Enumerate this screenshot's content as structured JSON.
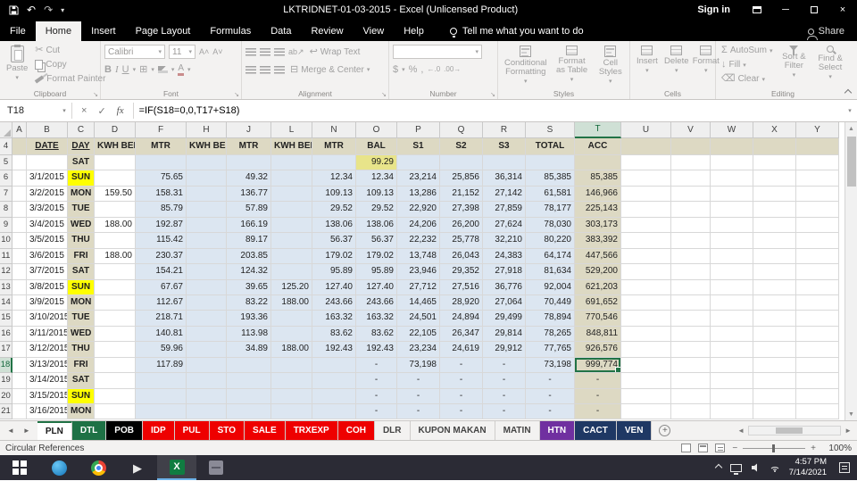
{
  "colors": {
    "accent_green": "#217346",
    "titlebar_bg": "#000000",
    "ribbon_bg": "#f3f2f1",
    "data_band_bg": "#dce6f1",
    "tan_bg": "#ddd9c3",
    "sun_bg": "#ffff00",
    "bal_bg": "#e8e48a",
    "excel_icon_green": "#107c41",
    "taskbar_bg": "#2b2b35"
  },
  "icons": {
    "dropdown": "▾",
    "launcher": "↘",
    "scissors": "✂",
    "undo": "↶",
    "redo": "↷",
    "check": "✓",
    "cancel": "×",
    "close": "×",
    "minimize": "─",
    "sigma": "Σ",
    "play": "▶",
    "up": "▲",
    "down": "▼",
    "left": "◄",
    "right": "►",
    "minus": "−",
    "plus": "+",
    "bold": "B",
    "italic": "I",
    "underline": "U",
    "dollar": "$",
    "percent": "%",
    "comma": ",",
    "dec_inc": "←.0",
    "dec_dec": ".00→",
    "wrap": "↩",
    "orientation": "ab↗",
    "grow_font": "A˄",
    "shrink_font": "A˅",
    "borders": "⊞",
    "merge": "⊟",
    "fill_down": "↓",
    "clear": "⌫",
    "sort_az": "AZ"
  },
  "titlebar": {
    "title": "LKTRIDNET-01-03-2015 - Excel (Unlicensed Product)",
    "sign_in": "Sign in"
  },
  "ribbon": {
    "tabs": [
      "File",
      "Home",
      "Insert",
      "Page Layout",
      "Formulas",
      "Data",
      "Review",
      "View",
      "Help"
    ],
    "active_tab": "Home",
    "tell_me": "Tell me what you want to do",
    "share": "Share",
    "groups": {
      "clipboard": {
        "label": "Clipboard",
        "paste": "Paste",
        "cut": "Cut",
        "copy": "Copy",
        "format_painter": "Format Painter"
      },
      "font": {
        "label": "Font",
        "name": "Calibri",
        "size": "11"
      },
      "alignment": {
        "label": "Alignment",
        "wrap": "Wrap Text",
        "merge": "Merge & Center"
      },
      "number": {
        "label": "Number",
        "format": ""
      },
      "styles": {
        "label": "Styles",
        "conditional": "Conditional Formatting",
        "table": "Format as Table",
        "cell": "Cell Styles"
      },
      "cells": {
        "label": "Cells",
        "insert": "Insert",
        "delete": "Delete",
        "format": "Format"
      },
      "editing": {
        "label": "Editing",
        "autosum": "AutoSum",
        "fill": "Fill",
        "clear": "Clear",
        "sort": "Sort & Filter",
        "find": "Find & Select"
      }
    }
  },
  "formula_bar": {
    "name_box": "T18",
    "fx": "fx",
    "formula": "=IF(S18=0,0,T17+S18)"
  },
  "grid": {
    "columns": [
      "A",
      "B",
      "C",
      "D",
      "F",
      "H",
      "J",
      "L",
      "N",
      "O",
      "P",
      "Q",
      "R",
      "S",
      "T",
      "U",
      "V",
      "W",
      "X",
      "Y"
    ],
    "selection": {
      "cell": "T18",
      "row": 18,
      "col": "T"
    },
    "rows": [
      {
        "n": 4,
        "type": "header",
        "cells": {
          "B": "DATE",
          "C": "DAY",
          "D": "KWH BELI",
          "F": "MTR",
          "H": "KWH BELI",
          "J": "MTR",
          "L": "KWH BELI",
          "N": "MTR",
          "O": "BAL",
          "P": "S1",
          "Q": "S2",
          "R": "S3",
          "S": "TOTAL",
          "T": "ACC"
        }
      },
      {
        "n": 5,
        "cells": {
          "C": "SAT",
          "O": "99.29"
        }
      },
      {
        "n": 6,
        "cells": {
          "B": "3/1/2015",
          "C": "SUN",
          "F": "75.65",
          "J": "49.32",
          "N": "12.34",
          "O": "12.34",
          "P": "23,214",
          "Q": "25,856",
          "R": "36,314",
          "S": "85,385",
          "T": "85,385"
        }
      },
      {
        "n": 7,
        "cells": {
          "B": "3/2/2015",
          "C": "MON",
          "D": "159.50",
          "F": "158.31",
          "J": "136.77",
          "N": "109.13",
          "O": "109.13",
          "P": "13,286",
          "Q": "21,152",
          "R": "27,142",
          "S": "61,581",
          "T": "146,966"
        }
      },
      {
        "n": 8,
        "cells": {
          "B": "3/3/2015",
          "C": "TUE",
          "F": "85.79",
          "J": "57.89",
          "N": "29.52",
          "O": "29.52",
          "P": "22,920",
          "Q": "27,398",
          "R": "27,859",
          "S": "78,177",
          "T": "225,143"
        }
      },
      {
        "n": 9,
        "cells": {
          "B": "3/4/2015",
          "C": "WED",
          "D": "188.00",
          "F": "192.87",
          "J": "166.19",
          "N": "138.06",
          "O": "138.06",
          "P": "24,206",
          "Q": "26,200",
          "R": "27,624",
          "S": "78,030",
          "T": "303,173"
        }
      },
      {
        "n": 10,
        "cells": {
          "B": "3/5/2015",
          "C": "THU",
          "F": "115.42",
          "J": "89.17",
          "N": "56.37",
          "O": "56.37",
          "P": "22,232",
          "Q": "25,778",
          "R": "32,210",
          "S": "80,220",
          "T": "383,392"
        }
      },
      {
        "n": 11,
        "cells": {
          "B": "3/6/2015",
          "C": "FRI",
          "D": "188.00",
          "F": "230.37",
          "J": "203.85",
          "N": "179.02",
          "O": "179.02",
          "P": "13,748",
          "Q": "26,043",
          "R": "24,383",
          "S": "64,174",
          "T": "447,566"
        }
      },
      {
        "n": 12,
        "cells": {
          "B": "3/7/2015",
          "C": "SAT",
          "F": "154.21",
          "J": "124.32",
          "N": "95.89",
          "O": "95.89",
          "P": "23,946",
          "Q": "29,352",
          "R": "27,918",
          "S": "81,634",
          "T": "529,200"
        }
      },
      {
        "n": 13,
        "cells": {
          "B": "3/8/2015",
          "C": "SUN",
          "F": "67.67",
          "J": "39.65",
          "L": "125.20",
          "N": "127.40",
          "O": "127.40",
          "P": "27,712",
          "Q": "27,516",
          "R": "36,776",
          "S": "92,004",
          "T": "621,203"
        }
      },
      {
        "n": 14,
        "cells": {
          "B": "3/9/2015",
          "C": "MON",
          "F": "112.67",
          "J": "83.22",
          "L": "188.00",
          "N": "243.66",
          "O": "243.66",
          "P": "14,465",
          "Q": "28,920",
          "R": "27,064",
          "S": "70,449",
          "T": "691,652"
        }
      },
      {
        "n": 15,
        "cells": {
          "B": "3/10/2015",
          "C": "TUE",
          "F": "218.71",
          "J": "193.36",
          "N": "163.32",
          "O": "163.32",
          "P": "24,501",
          "Q": "24,894",
          "R": "29,499",
          "S": "78,894",
          "T": "770,546"
        }
      },
      {
        "n": 16,
        "cells": {
          "B": "3/11/2015",
          "C": "WED",
          "F": "140.81",
          "J": "113.98",
          "N": "83.62",
          "O": "83.62",
          "P": "22,105",
          "Q": "26,347",
          "R": "29,814",
          "S": "78,265",
          "T": "848,811"
        }
      },
      {
        "n": 17,
        "cells": {
          "B": "3/12/2015",
          "C": "THU",
          "F": "59.96",
          "J": "34.89",
          "L": "188.00",
          "N": "192.43",
          "O": "192.43",
          "P": "23,234",
          "Q": "24,619",
          "R": "29,912",
          "S": "77,765",
          "T": "926,576"
        }
      },
      {
        "n": 18,
        "cells": {
          "B": "3/13/2015",
          "C": "FRI",
          "F": "117.89",
          "O": "-",
          "P": "73,198",
          "Q": "-",
          "R": "-",
          "S": "73,198",
          "T": "999,774"
        }
      },
      {
        "n": 19,
        "cells": {
          "B": "3/14/2015",
          "C": "SAT",
          "O": "-",
          "P": "-",
          "Q": "-",
          "R": "-",
          "S": "-",
          "T": "-"
        }
      },
      {
        "n": 20,
        "cells": {
          "B": "3/15/2015",
          "C": "SUN",
          "O": "-",
          "P": "-",
          "Q": "-",
          "R": "-",
          "S": "-",
          "T": "-"
        }
      },
      {
        "n": 21,
        "cells": {
          "B": "3/16/2015",
          "C": "MON",
          "O": "-",
          "P": "-",
          "Q": "-",
          "R": "-",
          "S": "-",
          "T": "-"
        }
      }
    ]
  },
  "sheet_tabs": {
    "tabs": [
      {
        "label": "PLN",
        "bg": "#ffffff",
        "fg": "#1a1a1a",
        "active": true
      },
      {
        "label": "DTL",
        "bg": "#1e7145",
        "fg": "#ffffff"
      },
      {
        "label": "POB",
        "bg": "#000000",
        "fg": "#ffffff"
      },
      {
        "label": "IDP",
        "bg": "#ee0000",
        "fg": "#ffffff"
      },
      {
        "label": "PUL",
        "bg": "#ee0000",
        "fg": "#ffffff"
      },
      {
        "label": "STO",
        "bg": "#ee0000",
        "fg": "#ffffff"
      },
      {
        "label": "SALE",
        "bg": "#ee0000",
        "fg": "#ffffff"
      },
      {
        "label": "TRXEXP",
        "bg": "#ee0000",
        "fg": "#ffffff"
      },
      {
        "label": "COH",
        "bg": "#ee0000",
        "fg": "#ffffff"
      },
      {
        "label": "DLR",
        "bg": "#f3f2f1",
        "fg": "#444444"
      },
      {
        "label": "KUPON MAKAN",
        "bg": "#f3f2f1",
        "fg": "#444444"
      },
      {
        "label": "MATIN",
        "bg": "#f3f2f1",
        "fg": "#444444"
      },
      {
        "label": "HTN",
        "bg": "#7030a0",
        "fg": "#ffffff"
      },
      {
        "label": "CACT",
        "bg": "#1f3864",
        "fg": "#ffffff"
      },
      {
        "label": "VEN",
        "bg": "#1f3864",
        "fg": "#ffffff"
      }
    ]
  },
  "status_bar": {
    "message": "Circular References",
    "zoom": "100%"
  },
  "taskbar": {
    "time": "4:57 PM",
    "date": "7/14/2021"
  }
}
